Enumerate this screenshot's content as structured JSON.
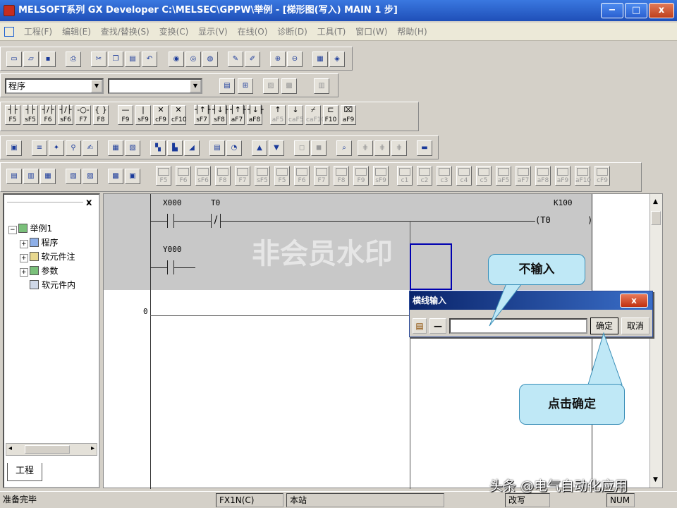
{
  "window": {
    "title": "MELSOFT系列 GX Developer C:\\MELSEC\\GPPW\\举例 - [梯形图(写入)   MAIN   1 步]",
    "minimize": "−",
    "maximize": "□",
    "close": "x"
  },
  "menu": [
    "工程(F)",
    "编辑(E)",
    "查找/替换(S)",
    "变换(C)",
    "显示(V)",
    "在线(O)",
    "诊断(D)",
    "工具(T)",
    "窗口(W)",
    "帮助(H)"
  ],
  "toolbar": {
    "program_select": "程序"
  },
  "keys_row1": [
    "F5",
    "sF5",
    "F6",
    "sF6",
    "F7",
    "F8",
    "F9",
    "sF9",
    "cF9",
    "cF10",
    "sF7",
    "sF8",
    "aF7",
    "aF8",
    "aF5",
    "caF5",
    "caF10",
    "F10",
    "aF9"
  ],
  "keys_row2": [
    "F5",
    "F6",
    "sF6",
    "F8",
    "F7",
    "sF5",
    "F5",
    "F6",
    "F7",
    "F8",
    "F9",
    "sF9",
    "c1",
    "c2",
    "c3",
    "c4",
    "c5",
    "aF5",
    "aF7",
    "aF8",
    "aF9",
    "aF10",
    "cF9"
  ],
  "project_panel": {
    "close": "x",
    "tree": [
      "举例1",
      "程序",
      "软元件注",
      "参数",
      "软元件内"
    ],
    "tab": "工程"
  },
  "ladder": {
    "contact1": "X000",
    "contact2": "T0",
    "contact3": "Y000",
    "coil": "(T0",
    "coil_end": ")",
    "constant": "K100",
    "step": "0",
    "watermark": "非会员水印"
  },
  "dialog": {
    "title": "横线输入",
    "close": "x",
    "value": "",
    "ok": "确定",
    "cancel": "取消"
  },
  "callouts": {
    "no_input": "不输入",
    "click_ok": "点击确定"
  },
  "status": {
    "ready": "准备完毕",
    "cpu": "FX1N(C)",
    "station": "本站",
    "mode": "改写",
    "num": "NUM"
  },
  "credit": "头条 @电气自动化应用"
}
